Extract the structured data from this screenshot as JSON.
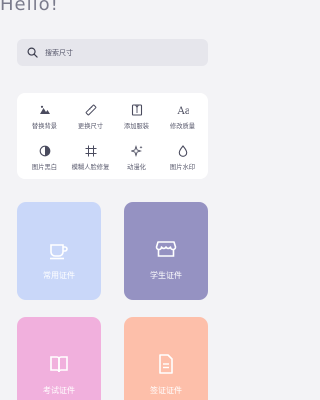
{
  "header": {
    "greeting": "Hello!"
  },
  "search": {
    "placeholder": "搜索尺寸",
    "icon": "search-icon"
  },
  "tools": [
    {
      "label": "替换背景",
      "icon": "landscape-icon"
    },
    {
      "label": "更换尺寸",
      "icon": "ruler-icon"
    },
    {
      "label": "添加服装",
      "icon": "shirt-icon"
    },
    {
      "label": "修改质量",
      "icon": "font-icon"
    },
    {
      "label": "图片黑白",
      "icon": "contrast-icon"
    },
    {
      "label": "模糊人脸修复",
      "icon": "crop-icon"
    },
    {
      "label": "动漫化",
      "icon": "sparkle-icon"
    },
    {
      "label": "图片水印",
      "icon": "drop-icon"
    }
  ],
  "cards": [
    {
      "label": "常用证件",
      "icon": "cup-icon",
      "color": "#c9d7f9"
    },
    {
      "label": "学生证件",
      "icon": "shop-icon",
      "color": "#9592c2"
    },
    {
      "label": "考试证件",
      "icon": "book-icon",
      "color": "#f1b0dd"
    },
    {
      "label": "签证证件",
      "icon": "document-icon",
      "color": "#fdbfaa"
    }
  ]
}
